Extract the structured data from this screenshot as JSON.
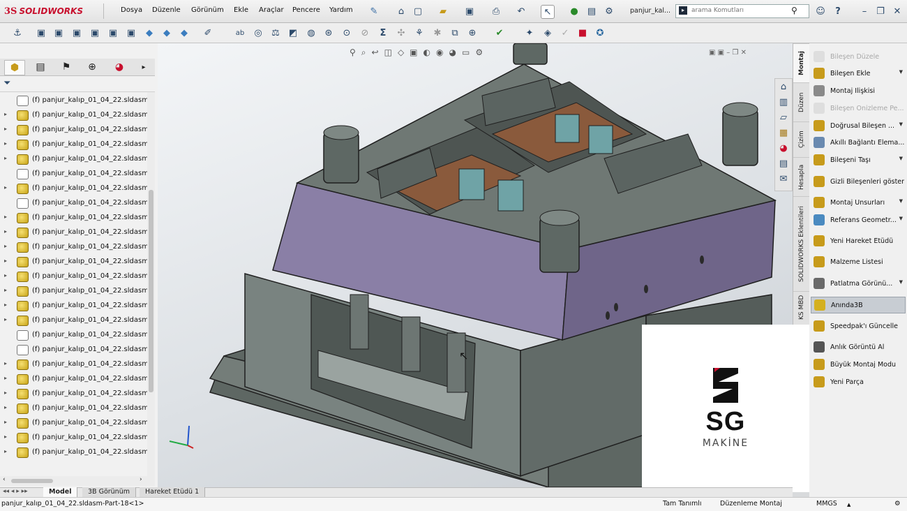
{
  "app": {
    "logo_prefix": "3S",
    "logo_name": "SOLIDWORKS"
  },
  "menu": [
    "Dosya",
    "Düzenle",
    "Görünüm",
    "Ekle",
    "Araçlar",
    "Pencere",
    "Yardım"
  ],
  "document_title": "panjur_kal...",
  "search": {
    "placeholder": "arama Komutları"
  },
  "tree_items": [
    {
      "label": "(f) panjur_kalıp_01_04_22.sldasm-",
      "expandable": false,
      "icon": "part-grey"
    },
    {
      "label": "(f) panjur_kalıp_01_04_22.sldasm-",
      "expandable": true,
      "icon": "subassembly-yellow"
    },
    {
      "label": "(f) panjur_kalıp_01_04_22.sldasm-",
      "expandable": true,
      "icon": "subassembly-yellow"
    },
    {
      "label": "(f) panjur_kalıp_01_04_22.sldasm-",
      "expandable": true,
      "icon": "subassembly-yellow"
    },
    {
      "label": "(f) panjur_kalıp_01_04_22.sldasm-",
      "expandable": true,
      "icon": "subassembly-yellow"
    },
    {
      "label": "(f) panjur_kalıp_01_04_22.sldasm-",
      "expandable": false,
      "icon": "part-grey"
    },
    {
      "label": "(f) panjur_kalıp_01_04_22.sldasm-",
      "expandable": true,
      "icon": "subassembly-yellow"
    },
    {
      "label": "(f) panjur_kalıp_01_04_22.sldasm-",
      "expandable": false,
      "icon": "part-grey"
    },
    {
      "label": "(f) panjur_kalıp_01_04_22.sldasm-",
      "expandable": true,
      "icon": "subassembly-yellow"
    },
    {
      "label": "(f) panjur_kalıp_01_04_22.sldasm-",
      "expandable": true,
      "icon": "subassembly-yellow"
    },
    {
      "label": "(f) panjur_kalıp_01_04_22.sldasm-",
      "expandable": true,
      "icon": "subassembly-yellow"
    },
    {
      "label": "(f) panjur_kalıp_01_04_22.sldasm-",
      "expandable": true,
      "icon": "subassembly-yellow"
    },
    {
      "label": "(f) panjur_kalıp_01_04_22.sldasm-",
      "expandable": true,
      "icon": "subassembly-yellow"
    },
    {
      "label": "(f) panjur_kalıp_01_04_22.sldasm-",
      "expandable": true,
      "icon": "subassembly-yellow"
    },
    {
      "label": "(f) panjur_kalıp_01_04_22.sldasm-",
      "expandable": true,
      "icon": "subassembly-yellow"
    },
    {
      "label": "(f) panjur_kalıp_01_04_22.sldasm-",
      "expandable": true,
      "icon": "subassembly-yellow"
    },
    {
      "label": "(f) panjur_kalıp_01_04_22.sldasm-",
      "expandable": false,
      "icon": "part-grey"
    },
    {
      "label": "(f) panjur_kalıp_01_04_22.sldasm-",
      "expandable": false,
      "icon": "part-grey"
    },
    {
      "label": "(f) panjur_kalıp_01_04_22.sldasm-",
      "expandable": true,
      "icon": "subassembly-yellow"
    },
    {
      "label": "(f) panjur_kalıp_01_04_22.sldasm-",
      "expandable": true,
      "icon": "subassembly-yellow"
    },
    {
      "label": "(f) panjur_kalıp_01_04_22.sldasm-",
      "expandable": true,
      "icon": "subassembly-yellow"
    },
    {
      "label": "(f) panjur_kalıp_01_04_22.sldasm-",
      "expandable": true,
      "icon": "subassembly-yellow"
    },
    {
      "label": "(f) panjur_kalıp_01_04_22.sldasm-",
      "expandable": true,
      "icon": "subassembly-yellow"
    },
    {
      "label": "(f) panjur_kalıp_01_04_22.sldasm-",
      "expandable": true,
      "icon": "subassembly-yellow"
    },
    {
      "label": "(f) panjur_kalıp_01_04_22.sldasm-",
      "expandable": true,
      "icon": "subassembly-yellow"
    }
  ],
  "vertical_tabs": [
    "Montaj",
    "Düzen",
    "Çizim",
    "Hesapla",
    "SOLIDWORKS Eklentileri",
    "KS MBD"
  ],
  "commands": [
    {
      "label": "Bileşen Düzele",
      "disabled": true,
      "dropdown": false,
      "selected": false
    },
    {
      "label": "Bileşen Ekle",
      "disabled": false,
      "dropdown": true,
      "selected": false
    },
    {
      "label": "Montaj İlişkisi",
      "disabled": false,
      "dropdown": false,
      "selected": false
    },
    {
      "label": "Bileşen Önizleme Pe...",
      "disabled": true,
      "dropdown": false,
      "selected": false
    },
    {
      "label": "Doğrusal Bileşen ...",
      "disabled": false,
      "dropdown": true,
      "selected": false
    },
    {
      "label": "Akıllı Bağlantı Elema...",
      "disabled": false,
      "dropdown": false,
      "selected": false
    },
    {
      "label": "Bileşeni Taşı",
      "disabled": false,
      "dropdown": true,
      "selected": false
    },
    {
      "label": "Gizli Bileşenleri göster",
      "disabled": false,
      "dropdown": false,
      "selected": false
    },
    {
      "label": "Montaj Unsurları",
      "disabled": false,
      "dropdown": true,
      "selected": false
    },
    {
      "label": "Referans Geometr...",
      "disabled": false,
      "dropdown": true,
      "selected": false
    },
    {
      "label": "Yeni Hareket Etüdü",
      "disabled": false,
      "dropdown": false,
      "selected": false
    },
    {
      "label": "Malzeme Listesi",
      "disabled": false,
      "dropdown": false,
      "selected": false
    },
    {
      "label": "Patlatma Görünü...",
      "disabled": false,
      "dropdown": true,
      "selected": false
    },
    {
      "label": "Anında3B",
      "disabled": false,
      "dropdown": false,
      "selected": true
    },
    {
      "label": "Speedpak'ı Güncelle",
      "disabled": false,
      "dropdown": false,
      "selected": false
    },
    {
      "label": "Anlık Görüntü Al",
      "disabled": false,
      "dropdown": false,
      "selected": false
    },
    {
      "label": "Büyük Montaj Modu",
      "disabled": false,
      "dropdown": false,
      "selected": false
    },
    {
      "label": "Yeni Parça",
      "disabled": false,
      "dropdown": false,
      "selected": false
    }
  ],
  "bottom_tabs": [
    "Model",
    "3B Görünüm",
    "Hareket Etüdü 1"
  ],
  "status": {
    "left": "panjur_kalıp_01_04_22.sldasm-Part-18<1>",
    "definition": "Tam Tanımlı",
    "mode": "Düzenleme Montaj",
    "units": "MMGS"
  },
  "watermark": {
    "brand": "SG",
    "sub": "MAKİNE"
  },
  "colors": {
    "accent": "#c8102e",
    "plate_purple": "#8a7fa6",
    "mold_grey": "#6f7874",
    "cavity_brown": "#8a5a3c",
    "insert_teal": "#6fa3a6"
  }
}
